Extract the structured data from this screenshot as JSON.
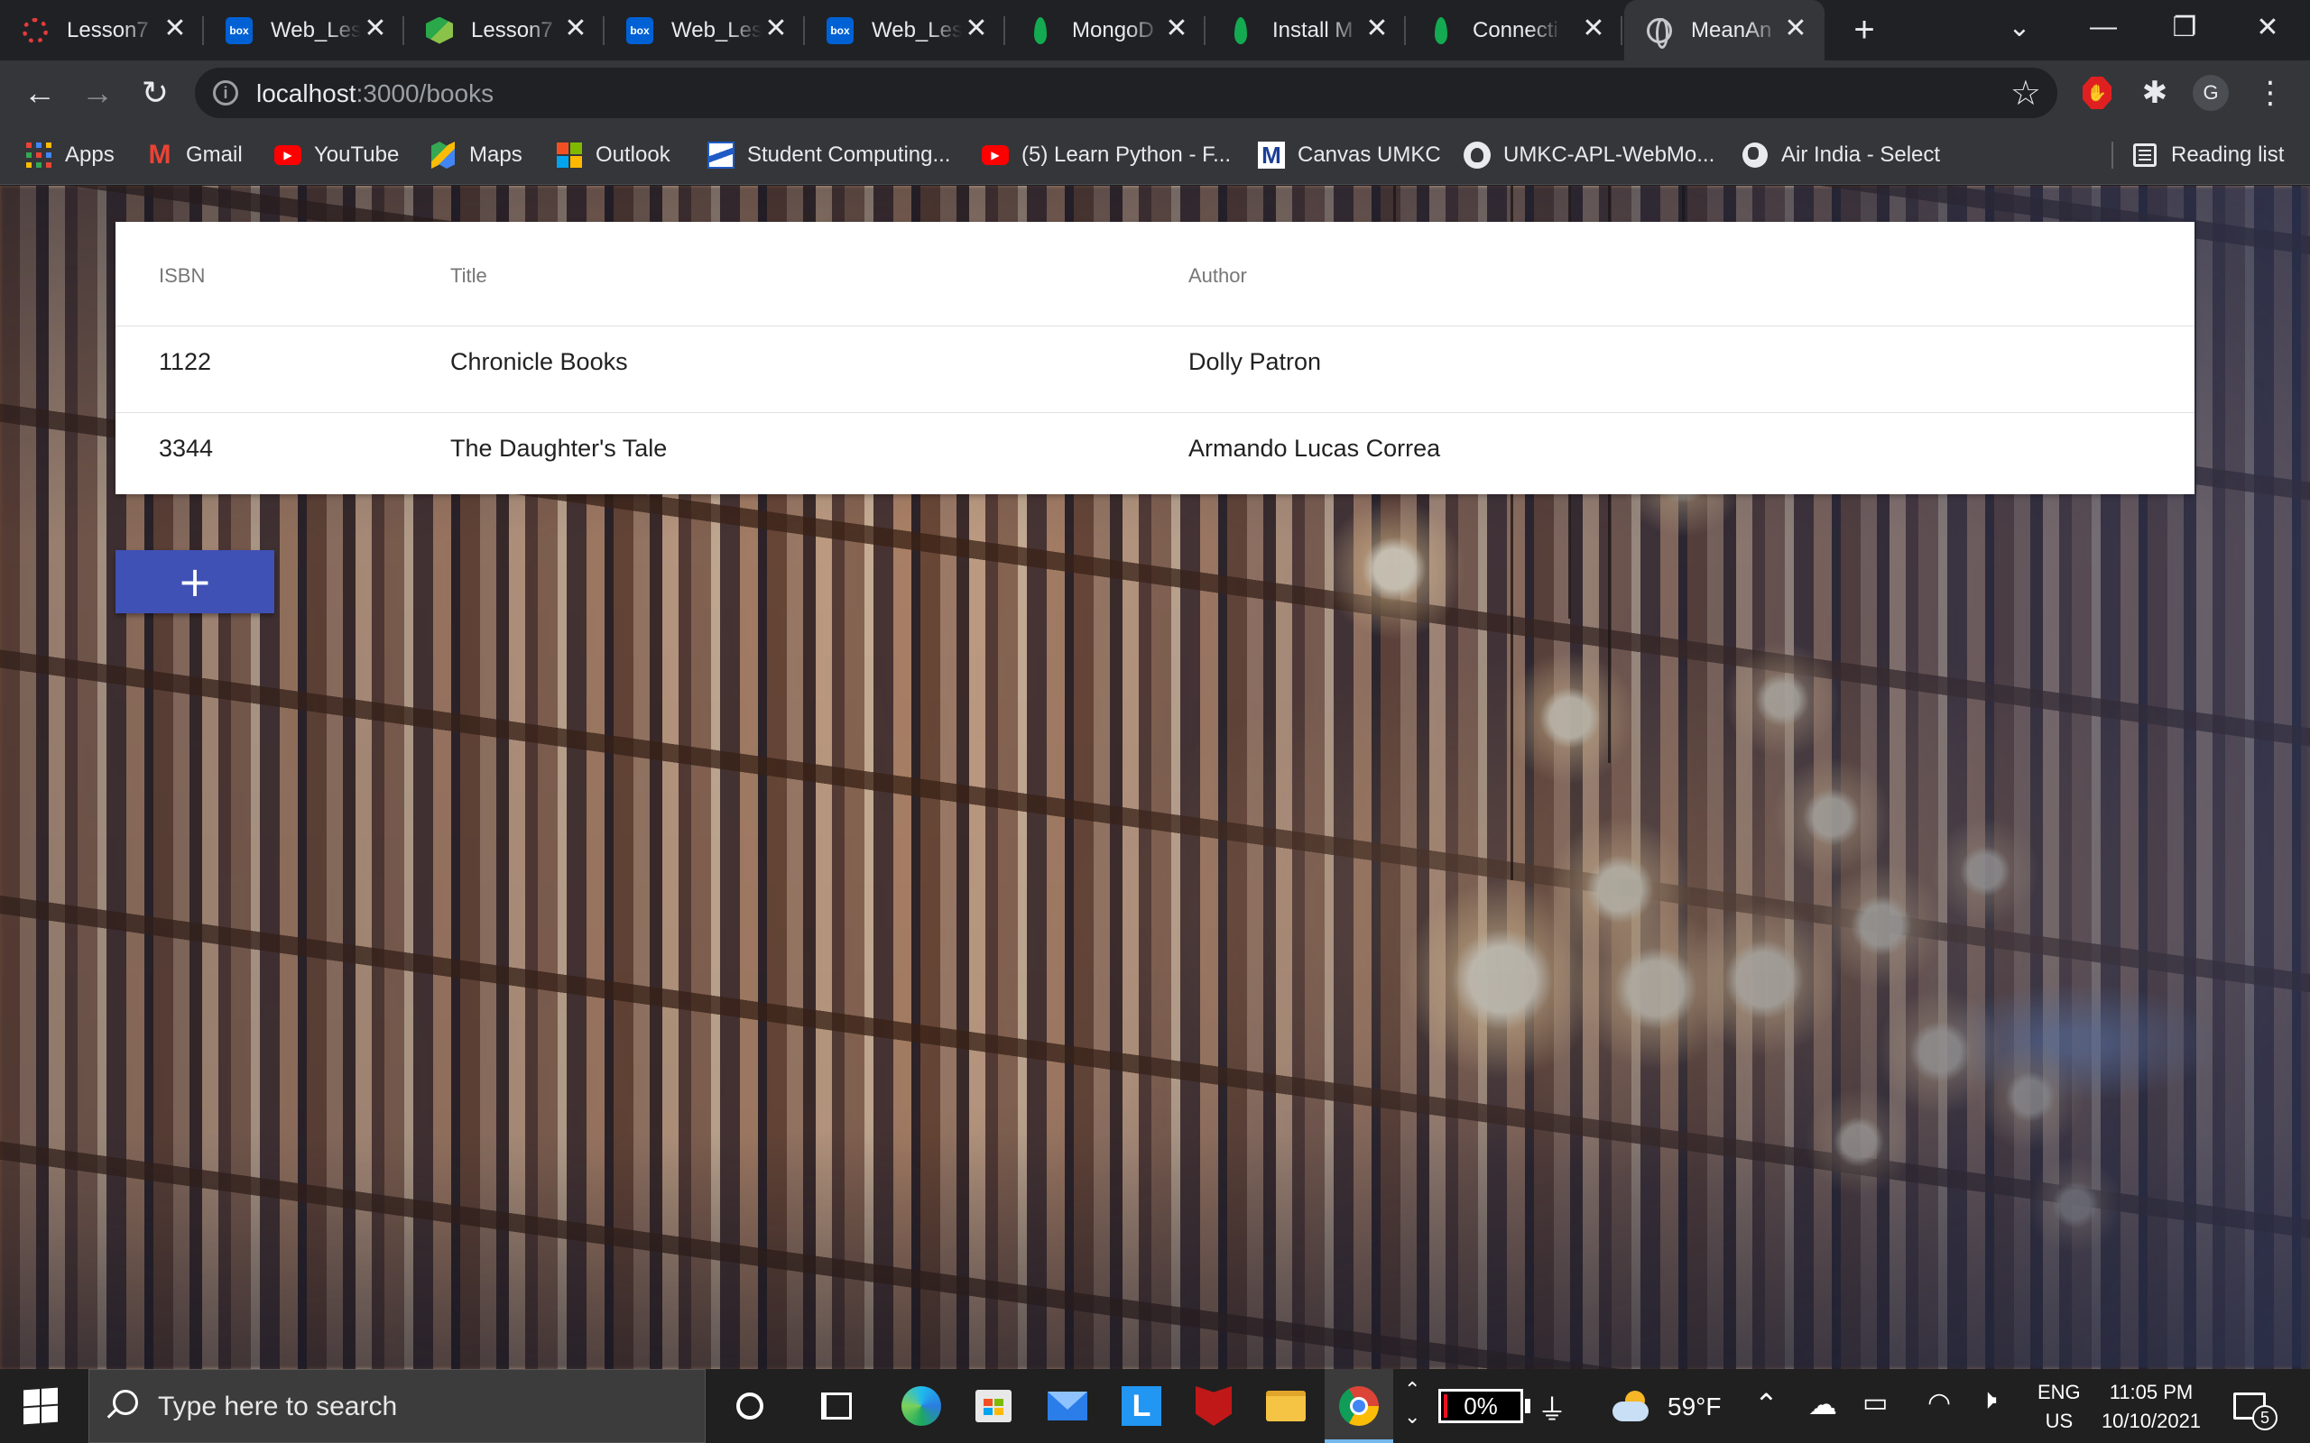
{
  "browser": {
    "tabs": [
      {
        "title": "Lesson7",
        "icon": "canvas-gear-icon",
        "active": false
      },
      {
        "title": "Web_Les",
        "icon": "box-icon",
        "active": false
      },
      {
        "title": "Lesson7",
        "icon": "hexagon-icon",
        "active": false
      },
      {
        "title": "Web_Les",
        "icon": "box-icon",
        "active": false
      },
      {
        "title": "Web_Les",
        "icon": "box-icon",
        "active": false
      },
      {
        "title": "MongoD",
        "icon": "mongodb-leaf-icon",
        "active": false
      },
      {
        "title": "Install M",
        "icon": "mongodb-leaf-icon",
        "active": false
      },
      {
        "title": "Connecti",
        "icon": "mongodb-leaf-icon",
        "active": false
      },
      {
        "title": "MeanAn",
        "icon": "globe-icon",
        "active": true
      }
    ],
    "favicon_box_text": "box",
    "address": {
      "host": "localhost",
      "path": ":3000/books"
    },
    "profile_initial": "G",
    "bookmarks": [
      {
        "label": "Apps",
        "icon": "apps-grid-icon"
      },
      {
        "label": "Gmail",
        "icon": "gmail-icon"
      },
      {
        "label": "YouTube",
        "icon": "youtube-icon"
      },
      {
        "label": "Maps",
        "icon": "maps-icon"
      },
      {
        "label": "Outlook",
        "icon": "microsoft-icon"
      },
      {
        "label": "Student Computing...",
        "icon": "student-computing-icon"
      },
      {
        "label": "(5) Learn Python - F...",
        "icon": "youtube-icon"
      },
      {
        "label": "Canvas UMKC",
        "icon": "canvas-icon"
      },
      {
        "label": "UMKC-APL-WebMo...",
        "icon": "github-icon"
      },
      {
        "label": "Air India - Select",
        "icon": "globe-icon"
      }
    ],
    "reading_list": "Reading list",
    "icons": {
      "gmail": "M",
      "canvas": "M",
      "plus": "+",
      "close": "✕"
    }
  },
  "books_table": {
    "columns": [
      "ISBN",
      "Title",
      "Author"
    ],
    "rows": [
      {
        "isbn": "1122",
        "title": "Chronicle Books",
        "author": "Dolly Patron"
      },
      {
        "isbn": "3344",
        "title": "The Daughter's Tale",
        "author": "Armando Lucas Correa"
      }
    ]
  },
  "add_button": {
    "label": "+",
    "color": "#3f51b5"
  },
  "taskbar": {
    "search_placeholder": "Type here to search",
    "battery": "0%",
    "weather": "59°F",
    "language": {
      "line1": "ENG",
      "line2": "US"
    },
    "time": "11:05 PM",
    "date": "10/10/2021",
    "notification_count": "5",
    "lblue_letter": "L"
  }
}
